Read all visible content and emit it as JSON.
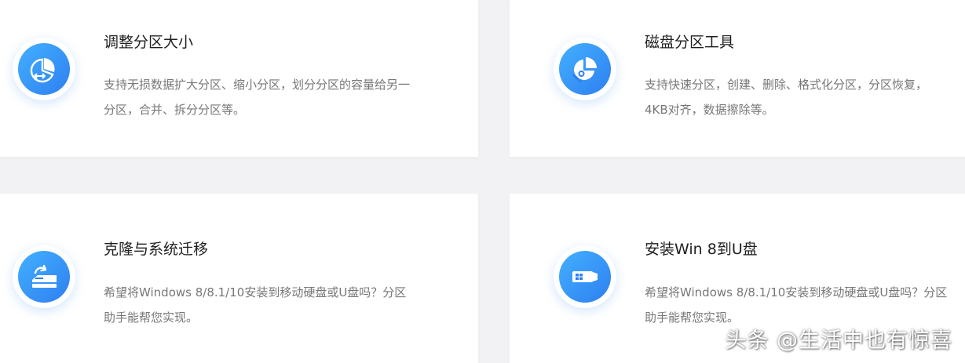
{
  "features": [
    {
      "title": "调整分区大小",
      "description": "支持无损数据扩大分区、缩小分区，划分分区的容量给另一分区，合并、拆分分区等。",
      "icon": "resize-partition-icon"
    },
    {
      "title": "磁盘分区工具",
      "description": "支持快速分区，创建、删除、格式化分区，分区恢复，4KB对齐，数据擦除等。",
      "icon": "disk-tool-icon"
    },
    {
      "title": "克隆与系统迁移",
      "description": "希望将Windows 8/8.1/10安装到移动硬盘或U盘吗？分区助手能帮您实现。",
      "icon": "clone-migrate-icon"
    },
    {
      "title": "安装Win 8到U盘",
      "description": "希望将Windows 8/8.1/10安装到移动硬盘或U盘吗？分区助手能帮您实现。",
      "icon": "usb-install-icon"
    }
  ],
  "watermark": "头条 @生活中也有惊喜",
  "colors": {
    "accent_start": "#43b0ff",
    "accent_end": "#2e7ff0",
    "title": "#1f1f1f",
    "description": "#777777",
    "background": "#f2f2f4"
  }
}
